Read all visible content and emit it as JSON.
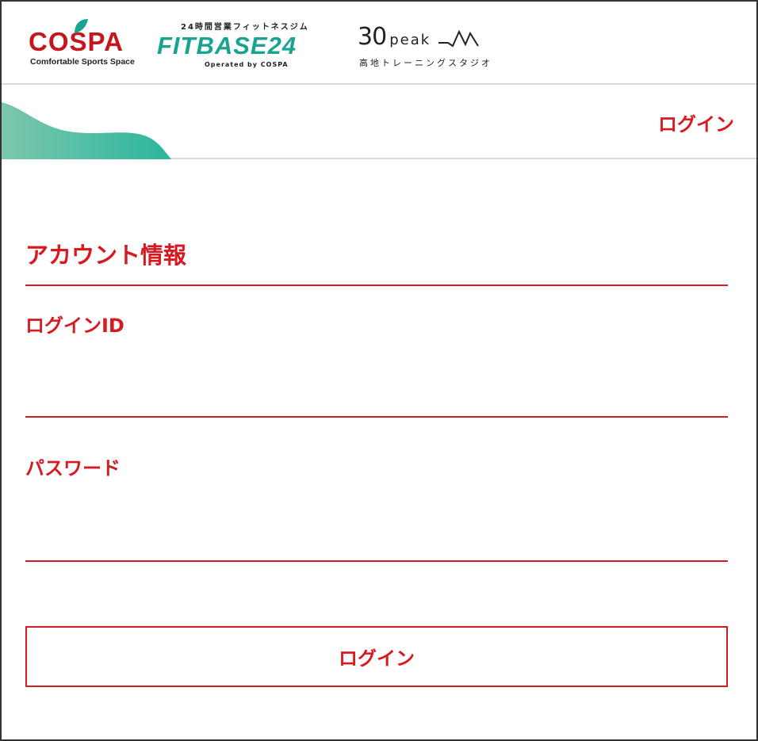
{
  "brands": {
    "cospa": {
      "name": "COSPA",
      "tagline": "Comfortable Sports Space"
    },
    "fitbase": {
      "top": "24時間営業フィットネスジム",
      "name": "FITBASE24",
      "operated": "Operated by COSPA"
    },
    "peak": {
      "number": "30",
      "word": "peak",
      "sub": "高地トレーニングスタジオ"
    }
  },
  "nav": {
    "login_label": "ログイン"
  },
  "form": {
    "section_title": "アカウント情報",
    "login_id": {
      "label": "ログインID",
      "value": "",
      "placeholder": ""
    },
    "password": {
      "label": "パスワード",
      "value": "",
      "placeholder": ""
    },
    "submit_label": "ログイン"
  },
  "colors": {
    "accent": "#d71920",
    "brand_green": "#1aa391",
    "cospa_red": "#c4161c",
    "divider": "#d9d9d9"
  },
  "icons": {
    "cospa_mark": "leaf-icon",
    "peak_mark": "heartbeat-icon",
    "decoration": "wave-icon"
  }
}
